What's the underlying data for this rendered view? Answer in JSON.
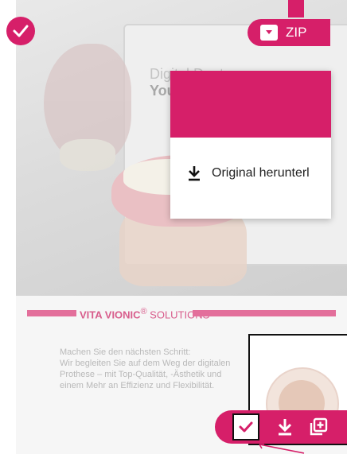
{
  "colors": {
    "accent": "#d61f69",
    "banner": "#e36f9b"
  },
  "preview": {
    "title_line": "Digital Dentures:",
    "subtitle_line": "Your"
  },
  "toolbar": {
    "select_icon": "check-icon",
    "zip_label": "ZIP",
    "zip_icon": "archive-download-icon"
  },
  "dropdown": {
    "item_label": "Original herunterl",
    "item_icon": "download-icon"
  },
  "banner": {
    "brand": "VITA VIONIC",
    "registered": "®",
    "suffix": " SOLUTIONS"
  },
  "description": [
    "Machen Sie den nächsten Schritt:",
    "Wir begleiten Sie auf dem Weg der digitalen",
    "Prothese – mit Top-Qualität, -Ästhetik und",
    "einem Mehr an Effizienz und Flexibilität."
  ],
  "action_bar": {
    "icons": [
      "check-icon",
      "download-icon",
      "add-to-collection-icon"
    ]
  }
}
